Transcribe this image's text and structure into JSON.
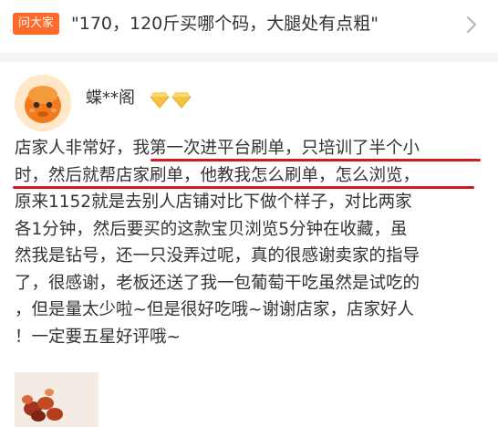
{
  "ask_bar": {
    "badge": "问大家",
    "question": "\"170，120斤买哪个码，大腿处有点粗\"",
    "icon": "chevron-right-icon"
  },
  "review": {
    "username": "蝶**阁",
    "badges": [
      "diamond-icon",
      "diamond-icon"
    ],
    "lines": [
      "店家人非常好，我第一次进平台刷单，只培训了半个小",
      "时，然后就帮店家刷单，他教我怎么刷单，怎么浏览，",
      "原来1152就是去别人店铺对比下做个样子，对比两家",
      "各1分钟，然后要买的这款宝贝浏览5分钟在收藏，虽",
      "然我是钻号，还一只没弄过呢，真的很感谢卖家的指导",
      "了，很感谢，老板还送了我一包葡萄干吃虽然是试吃的",
      "，但是量太少啦~但是很好吃哦~谢谢店家，店家好人",
      "！一定要五星好评哦~"
    ]
  },
  "colors": {
    "badge_bg": "#ff6a2a",
    "underline": "#d7171f",
    "diamond": "#f5c242"
  }
}
